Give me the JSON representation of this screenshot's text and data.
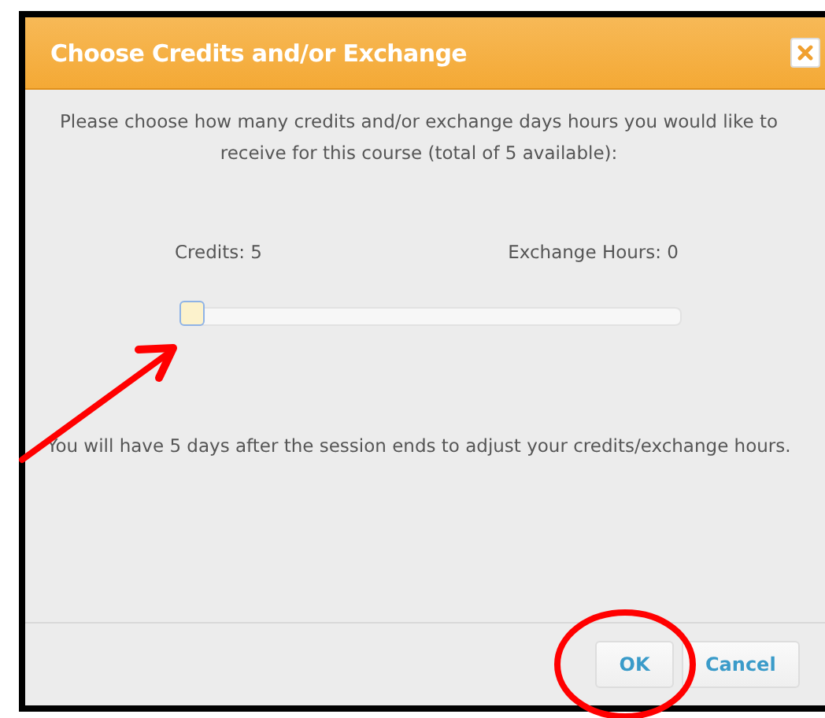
{
  "dialog": {
    "title": "Choose Credits and/or Exchange",
    "intro": "Please choose how many credits and/or exchange days hours you would like to receive for this course (total of 5 available):",
    "credits_label": "Credits: 5",
    "exchange_label": "Exchange Hours: 0",
    "slider": {
      "level": 0
    },
    "note": "You will have 5 days after the session ends to adjust your credits/exchange hours.",
    "buttons": [
      {
        "label": "OK"
      },
      {
        "label": "Cancel"
      }
    ]
  }
}
